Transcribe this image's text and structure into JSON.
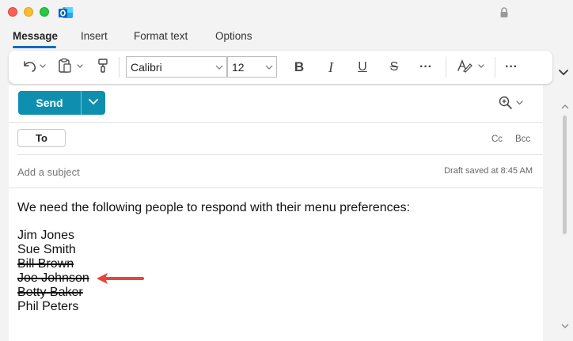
{
  "tabs": [
    {
      "label": "Message",
      "active": true
    },
    {
      "label": "Insert",
      "active": false
    },
    {
      "label": "Format text",
      "active": false
    },
    {
      "label": "Options",
      "active": false
    }
  ],
  "toolbar": {
    "font_name": "Calibri",
    "font_size": "12",
    "bold_label": "B",
    "italic_label": "I",
    "underline_label": "U",
    "strike_label": "S",
    "more_label": "···",
    "more2_label": "···"
  },
  "compose": {
    "send_label": "Send",
    "to_label": "To",
    "cc_label": "Cc",
    "bcc_label": "Bcc",
    "subject_placeholder": "Add a subject",
    "draft_status": "Draft saved at 8:45 AM"
  },
  "body": {
    "intro": "We need the following people to respond with their menu preferences:",
    "names": [
      {
        "name": "Jim Jones",
        "struck": false
      },
      {
        "name": "Sue Smith",
        "struck": false
      },
      {
        "name": "Bill Brown",
        "struck": true
      },
      {
        "name": "Joe Johnson",
        "struck": true
      },
      {
        "name": "Betty Baker",
        "struck": true
      },
      {
        "name": "Phil Peters",
        "struck": false
      }
    ]
  },
  "colors": {
    "accent": "#0f6cbd",
    "send": "#0f8fb0",
    "annotation_arrow": "#e8453c"
  }
}
